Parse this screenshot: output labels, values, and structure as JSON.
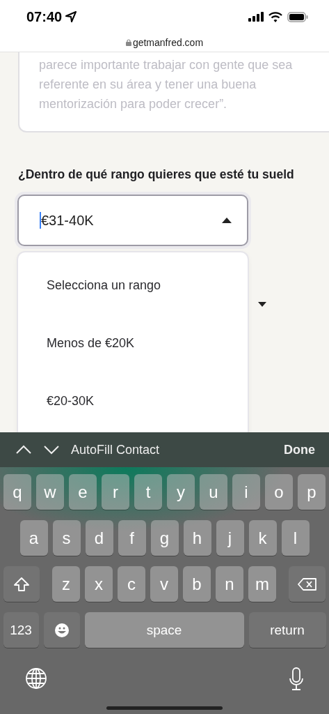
{
  "status_bar": {
    "time": "07:40"
  },
  "url_bar": {
    "domain": "getmanfred.com"
  },
  "answer_card": {
    "text": "parece importante trabajar con gente que sea\nreferente en su área y tener una buena\nmentorización para poder crecer”."
  },
  "question": {
    "label": "¿Dentro de qué rango quieres que esté tu sueld"
  },
  "salary_select": {
    "value": "€31-40K",
    "expanded": true,
    "options": [
      {
        "label": "Selecciona un rango"
      },
      {
        "label": "Menos de €20K"
      },
      {
        "label": "€20-30K"
      }
    ]
  },
  "keyboard": {
    "toolbar_label": "AutoFill Contact",
    "done": "Done",
    "rows": [
      [
        "q",
        "w",
        "e",
        "r",
        "t",
        "y",
        "u",
        "i",
        "o",
        "p"
      ],
      [
        "a",
        "s",
        "d",
        "f",
        "g",
        "h",
        "j",
        "k",
        "l"
      ],
      [
        "z",
        "x",
        "c",
        "v",
        "b",
        "n",
        "m"
      ]
    ],
    "number_key": "123",
    "space_key": "space",
    "return_key": "return"
  }
}
